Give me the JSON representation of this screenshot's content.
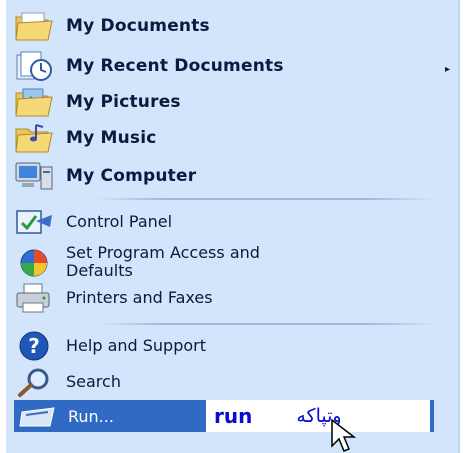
{
  "menu": {
    "items": [
      {
        "label": "My Documents",
        "icon": "my-documents-folder-icon"
      },
      {
        "label": "My Recent Documents",
        "icon": "recent-documents-icon",
        "submenu_arrow": "▸"
      },
      {
        "label": "My Pictures",
        "icon": "my-pictures-folder-icon"
      },
      {
        "label": "My Music",
        "icon": "my-music-folder-icon"
      },
      {
        "label": "My Computer",
        "icon": "my-computer-icon"
      }
    ],
    "system_items": [
      {
        "label": "Control Panel",
        "icon": "control-panel-icon"
      },
      {
        "label": "Set Program Access and\nDefaults",
        "icon": "program-access-icon"
      },
      {
        "label": "Printers and Faxes",
        "icon": "printer-icon"
      }
    ],
    "help_items": [
      {
        "label": "Help and Support",
        "icon": "help-icon"
      },
      {
        "label": "Search",
        "icon": "search-icon"
      }
    ],
    "run": {
      "label": "Run...",
      "icon": "run-icon",
      "annotation_en": "run",
      "annotation_ar": "وتپاکه"
    }
  },
  "colors": {
    "menu_bg": "#d3e5fa",
    "highlight": "#316ac5",
    "annotation_text": "#0b0bd0"
  }
}
